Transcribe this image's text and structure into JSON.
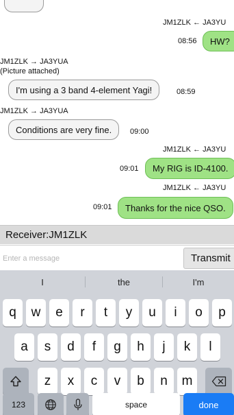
{
  "chat": {
    "messages": [
      {
        "dir": "in",
        "header": "JM1ZLK ← JA3YU",
        "time": "08:56",
        "text": "HW?"
      },
      {
        "dir": "out",
        "header": "JM1ZLK → JA3YUA",
        "note": "(Picture attached)",
        "text": "I'm using a 3 band 4-element Yagi!",
        "time": "08:59"
      },
      {
        "dir": "out",
        "header": "JM1ZLK → JA3YUA",
        "text": "Conditions are very fine.",
        "time": "09:00"
      },
      {
        "dir": "in",
        "header": "JM1ZLK ← JA3YU",
        "time": "09:01",
        "text": "My RIG is ID-4100."
      },
      {
        "dir": "in",
        "header": "JM1ZLK ← JA3YU",
        "time": "09:01",
        "text": "Thanks for the nice QSO."
      }
    ]
  },
  "receiver": {
    "label": "Receiver:JM1ZLK"
  },
  "composer": {
    "placeholder": "Enter a message",
    "value": "",
    "transmit_label": "Transmit"
  },
  "keyboard": {
    "suggestions": [
      "I",
      "the",
      "I'm"
    ],
    "row1": [
      "q",
      "w",
      "e",
      "r",
      "t",
      "y",
      "u",
      "i",
      "o",
      "p"
    ],
    "row2": [
      "a",
      "s",
      "d",
      "f",
      "g",
      "h",
      "j",
      "k",
      "l"
    ],
    "row3": [
      "z",
      "x",
      "c",
      "v",
      "b",
      "n",
      "m"
    ],
    "numbers_label": "123",
    "space_label": "space",
    "done_label": "done",
    "icons": [
      "shift-icon",
      "backspace-icon",
      "globe-icon",
      "microphone-icon"
    ],
    "accent_color": "#1a7cf5"
  },
  "colors": {
    "incoming_bubble": "#9fe285",
    "outgoing_bubble": "#f4f4f4"
  }
}
